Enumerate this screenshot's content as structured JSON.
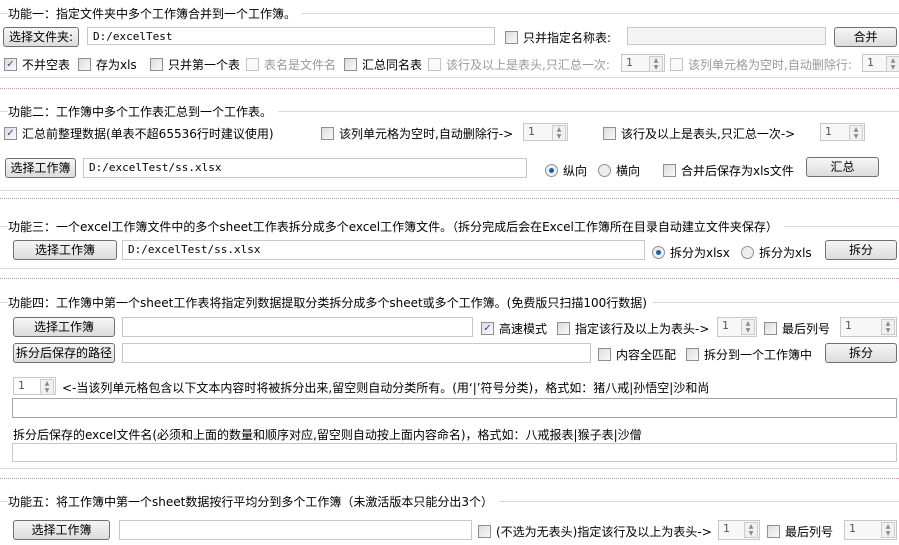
{
  "s1": {
    "title": "功能一：指定文件夹中多个工作簿合并到一个工作簿。",
    "select_folder": "选择文件夹:",
    "folder_path": "D:/excelTest",
    "only_named_label": "只并指定名称表:",
    "only_named_value": "",
    "merge": "合并",
    "opts": [
      "不并空表",
      "存为xls",
      "只并第一个表",
      "表名是文件名",
      "汇总同名表",
      "该行及以上是表头,只汇总一次:",
      "该列单元格为空时,自动删除行:"
    ],
    "header_row": "1",
    "empty_col": "1"
  },
  "s2": {
    "title": "功能二：工作簿中多个工作表汇总到一个工作表。",
    "tidy": "汇总前整理数据(单表不超65536行时建议使用)",
    "empty_col_label": "该列单元格为空时,自动删除行->",
    "empty_col": "1",
    "header_label": "该行及以上是表头,只汇总一次->",
    "header_row": "1",
    "select": "选择工作簿",
    "path": "D:/excelTest/ss.xlsx",
    "vertical": "纵向",
    "horizontal": "横向",
    "save_xls": "合并后保存为xls文件",
    "summarize": "汇总"
  },
  "s3": {
    "title": "功能三：一个excel工作簿文件中的多个sheet工作表拆分成多个excel工作簿文件。（拆分完成后会在Excel工作簿所在目录自动建立文件夹保存）",
    "select": "选择工作簿",
    "path": "D:/excelTest/ss.xlsx",
    "xlsx": "拆分为xlsx",
    "xls": "拆分为xls",
    "split": "拆分"
  },
  "s4": {
    "title": "功能四：工作簿中第一个sheet工作表将指定列数据提取分类拆分成多个sheet或多个工作簿。(免费版只扫描100行数据)",
    "select": "选择工作簿",
    "path": "",
    "fast": "高速模式",
    "header_label": "指定该行及以上为表头->",
    "header_row": "1",
    "last_col_label": "最后列号",
    "last_col": "1",
    "save_path_btn": "拆分后保存的路径",
    "save_path": "",
    "exact": "内容全匹配",
    "one_book": "拆分到一个工作簿中",
    "split": "拆分",
    "col": "1",
    "filter_hint": "<-当该列单元格包含以下文本内容时将被拆分出来,留空则自动分类所有。(用‘|’符号分类)，格式如：猪八戒|孙悟空|沙和尚",
    "filter_value": "",
    "names_hint": "拆分后保存的excel文件名(必须和上面的数量和顺序对应,留空则自动按上面内容命名)，格式如：八戒报表|猴子表|沙僧",
    "names_value": ""
  },
  "s5": {
    "title": "功能五：将工作簿中第一个sheet数据按行平均分到多个工作簿（未激活版本只能分出3个）",
    "select": "选择工作簿",
    "path": "",
    "header_label": "(不选为无表头)指定该行及以上为表头->",
    "header_row": "1",
    "last_col_label": "最后列号",
    "last_col": "1"
  }
}
